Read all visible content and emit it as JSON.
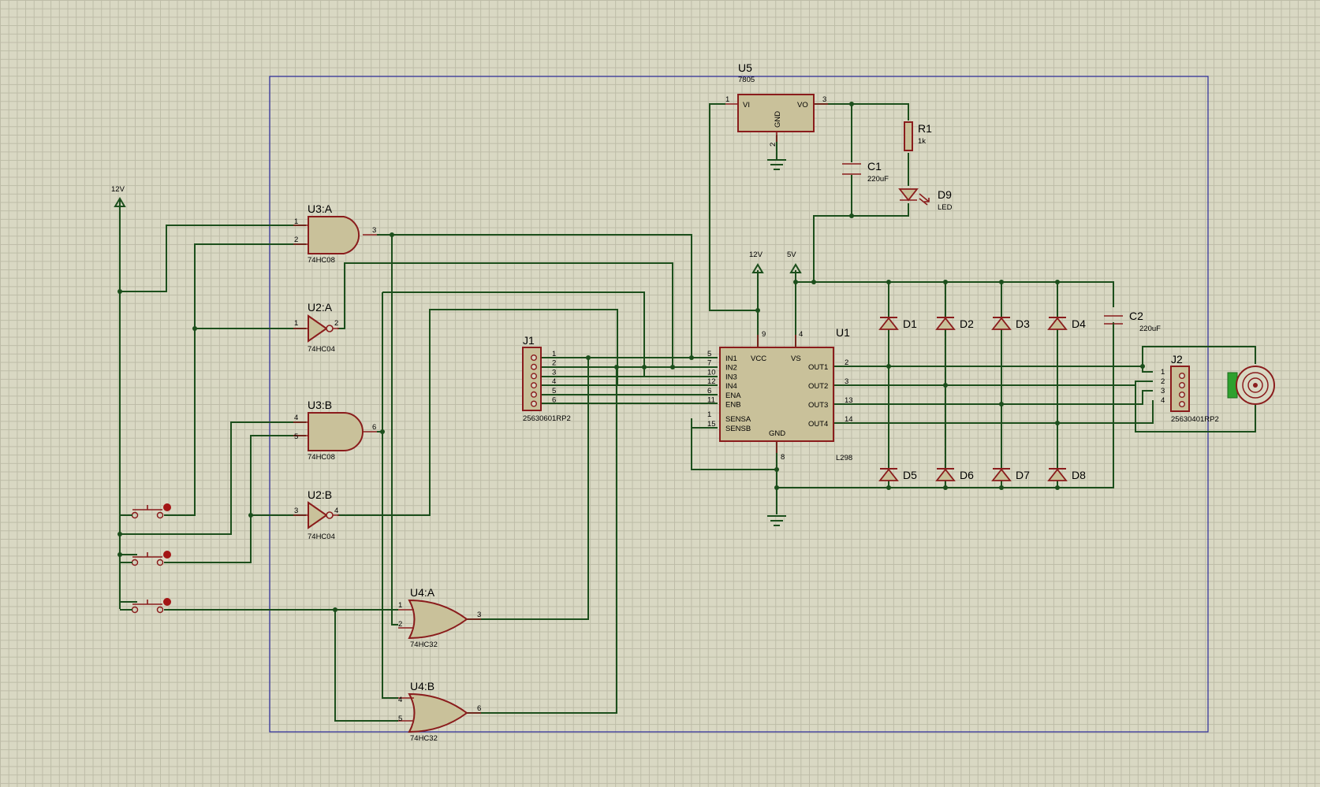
{
  "labels": {
    "U5": {
      "ref": "U5",
      "value": "7805",
      "pins": {
        "vi": "VI",
        "vo": "VO",
        "gnd": "GND",
        "p1": "1",
        "p2": "2",
        "p3": "3"
      }
    },
    "R1": {
      "ref": "R1",
      "value": "1k"
    },
    "C1": {
      "ref": "C1",
      "value": "220uF"
    },
    "C2": {
      "ref": "C2",
      "value": "220uF"
    },
    "D9": {
      "ref": "D9",
      "value": "LED"
    },
    "U3A": {
      "ref": "U3:A",
      "value": "74HC08",
      "pins": [
        "1",
        "2",
        "3"
      ]
    },
    "U2A": {
      "ref": "U2:A",
      "value": "74HC04",
      "pins": [
        "1",
        "2"
      ]
    },
    "U3B": {
      "ref": "U3:B",
      "value": "74HC08",
      "pins": [
        "4",
        "5",
        "6"
      ]
    },
    "U2B": {
      "ref": "U2:B",
      "value": "74HC04",
      "pins": [
        "3",
        "4"
      ]
    },
    "U4A": {
      "ref": "U4:A",
      "value": "74HC32",
      "pins": [
        "1",
        "2",
        "3"
      ]
    },
    "U4B": {
      "ref": "U4:B",
      "value": "74HC32",
      "pins": [
        "4",
        "5",
        "6"
      ]
    },
    "J1": {
      "ref": "J1",
      "value": "25630601RP2",
      "pins": [
        "1",
        "2",
        "3",
        "4",
        "5",
        "6"
      ]
    },
    "J2": {
      "ref": "J2",
      "value": "25630401RP2",
      "pins": [
        "1",
        "2",
        "3",
        "4"
      ]
    },
    "U1": {
      "ref": "U1",
      "value": "L298",
      "left_pins": [
        {
          "name": "IN1",
          "num": "5"
        },
        {
          "name": "IN2",
          "num": "7"
        },
        {
          "name": "IN3",
          "num": "10"
        },
        {
          "name": "IN4",
          "num": "12"
        },
        {
          "name": "ENA",
          "num": "6"
        },
        {
          "name": "ENB",
          "num": "11"
        },
        {
          "name": "SENSA",
          "num": "1"
        },
        {
          "name": "SENSB",
          "num": "15"
        }
      ],
      "right_pins": [
        {
          "name": "OUT1",
          "num": "2"
        },
        {
          "name": "OUT2",
          "num": "3"
        },
        {
          "name": "OUT3",
          "num": "13"
        },
        {
          "name": "OUT4",
          "num": "14"
        }
      ],
      "top": {
        "vcc": "VCC",
        "vs": "VS",
        "p9": "9",
        "p4": "4"
      },
      "bottom": {
        "gnd": "GND",
        "p8": "8"
      }
    },
    "power": {
      "v12_left": "12V",
      "v12_top": "12V",
      "v5": "5V"
    },
    "diodes": [
      "D1",
      "D2",
      "D3",
      "D4",
      "D5",
      "D6",
      "D7",
      "D8"
    ]
  },
  "colors": {
    "wire": "#1c4f1c",
    "component": "#8a1c1c",
    "body_fill": "#c9c19a",
    "frame": "#2a2a9a",
    "sheet": "#d9d8c3",
    "button_cap": "#a31515",
    "motor_tab": "#2ea02e"
  }
}
